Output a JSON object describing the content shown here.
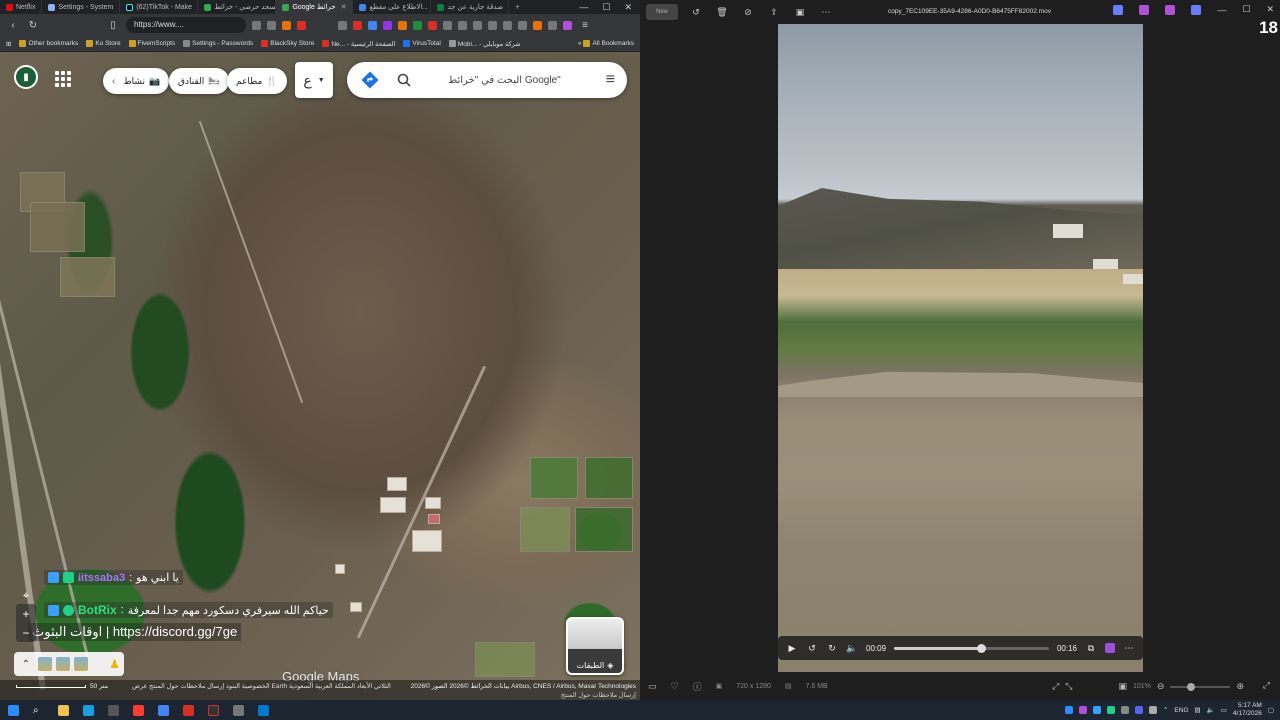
{
  "browser": {
    "tabs": [
      {
        "label": "Netflix",
        "active": false
      },
      {
        "label": "Settings - System",
        "active": false
      },
      {
        "label": "(62)TikTok - Make",
        "active": false
      },
      {
        "label": "مسجد حرصي - خرائط",
        "active": false
      },
      {
        "label": "Google خرائط",
        "active": true
      },
      {
        "label": "الاطلاع على مقطع...",
        "active": false
      },
      {
        "label": "صدقة جارية عن جد",
        "active": false
      }
    ],
    "url": "https://www....",
    "bookmarks": [
      "Other bookmarks",
      "Ko Store",
      "FivemScripts",
      "Settings - Passwords",
      "BlackSky Store",
      "Ne... - الصفحة الرئيسية",
      "VirusTotal",
      "Mobi... - شركة موبايلي"
    ],
    "all_bookmarks": "All Bookmarks"
  },
  "maps": {
    "search_placeholder": "البحث في \"خرائط Google\"",
    "lang_label": "ع",
    "chips": {
      "activities": "نشاط",
      "hotels": "الفنادق",
      "restaurants": "مطاعم"
    },
    "layers_label": "الطبقات",
    "logo": "Google Maps",
    "footer": {
      "scale": "50 متر",
      "links": "الخصوصية   البنود   إرسال ملاحظات حول المنتج   عرض Earth الثلاثي الأبعاد   المملكة العربية السعودية",
      "copyright": "بيانات الخرائط ©2026 الصور ©2026 Airbus, CNES / Airbus, Maxar Technologies",
      "feedback": "إرسال ملاحظات حول المنتج"
    }
  },
  "chat": [
    {
      "user": "iitssaba3",
      "message": "يا ابني هو"
    },
    {
      "user": "BotRix",
      "message": "حياكم الله سيرفري دسكورد مهم جدا لمعرفة"
    },
    {
      "user": "",
      "message": "اوقات البثوث | https://discord.gg/7ge"
    }
  ],
  "player": {
    "title": "copy_7EC109EE-35A9-4286-A0D0-B6475FF82002.mov",
    "current_time": "00:09",
    "duration": "00:16",
    "progress": 0.56,
    "resolution": "720 x 1280",
    "file_size": "7.6 MB",
    "zoom": "101%",
    "zoom_level": 0.35
  },
  "overlay_badge": "18",
  "taskbar": {
    "language": "ENG",
    "time": "5:17 AM",
    "date": "4/17/2026"
  },
  "colors": {
    "map_accent": "#1a73e8",
    "chat_user1": "#b070ff",
    "chat_user2": "#2fe07a",
    "player_bg": "#1e1e1e"
  }
}
